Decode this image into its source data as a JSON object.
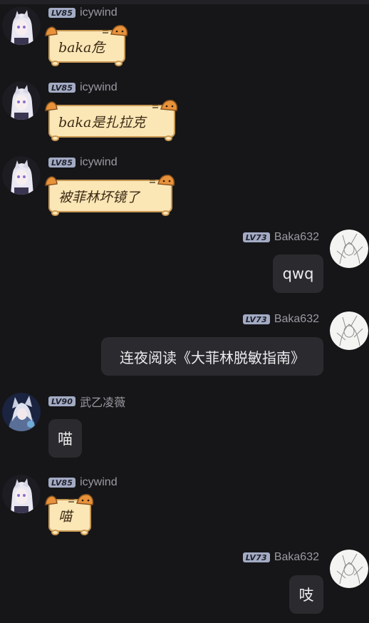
{
  "messages": [
    {
      "sender": "icywind",
      "level": "LV85",
      "text": "baka危",
      "side": "left",
      "style": "cat",
      "avatar": "white-hair-anime-avatar"
    },
    {
      "sender": "icywind",
      "level": "LV85",
      "text": "baka是扎拉克",
      "side": "left",
      "style": "cat",
      "avatar": "white-hair-anime-avatar"
    },
    {
      "sender": "icywind",
      "level": "LV85",
      "text": "被菲林坏镜了",
      "side": "left",
      "style": "cat",
      "avatar": "white-hair-anime-avatar"
    },
    {
      "sender": "Baka632",
      "level": "LV73",
      "text": "qwq",
      "side": "right",
      "style": "dark",
      "avatar": "sketch-avatar"
    },
    {
      "sender": "Baka632",
      "level": "LV73",
      "text": "连夜阅读《大菲林脱敏指南》",
      "side": "right",
      "style": "dark",
      "avatar": "sketch-avatar"
    },
    {
      "sender": "武乙凌薇",
      "level": "LV90",
      "text": "喵",
      "side": "left",
      "style": "dark",
      "avatar": "cat-ear-girl-avatar"
    },
    {
      "sender": "icywind",
      "level": "LV85",
      "text": "喵",
      "side": "left",
      "style": "cat",
      "avatar": "white-hair-anime-avatar"
    },
    {
      "sender": "Baka632",
      "level": "LV73",
      "text": "吱",
      "side": "right",
      "style": "dark",
      "avatar": "sketch-avatar"
    }
  ],
  "colors": {
    "background": "#161618",
    "dark_bubble": "#2b2b2f",
    "cat_bubble": "#fbe6b6",
    "cat_border": "#c99a55",
    "level_badge": "#a3abc4",
    "username": "#9a9aa2"
  }
}
